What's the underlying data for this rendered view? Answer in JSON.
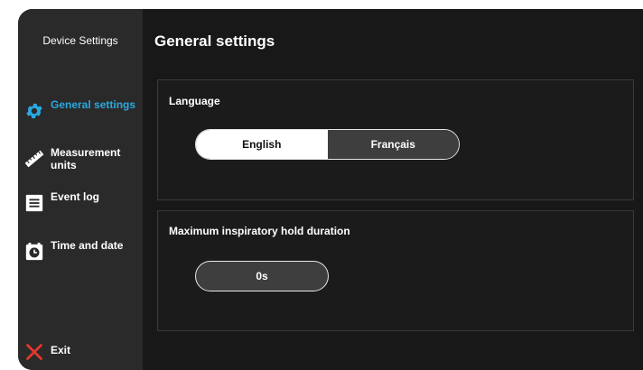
{
  "sidebar": {
    "title": "Device Settings",
    "items": [
      {
        "label": "General settings",
        "icon": "gear-icon",
        "active": true
      },
      {
        "label": "Measurement units",
        "icon": "ruler-icon",
        "active": false
      },
      {
        "label": "Event log",
        "icon": "event-log-icon",
        "active": false
      },
      {
        "label": "Time and date",
        "icon": "clock-icon",
        "active": false
      }
    ],
    "exit_label": "Exit",
    "exit_icon": "close-icon"
  },
  "main": {
    "title": "General settings",
    "language": {
      "label": "Language",
      "options": [
        "English",
        "Français"
      ],
      "selected": "English"
    },
    "hold": {
      "label": "Maximum inspiratory hold duration",
      "value": "0s"
    }
  },
  "colors": {
    "accent": "#2aa9e0",
    "exit": "#e8372a",
    "background": "#181818",
    "sidebar": "#2a2a2a"
  }
}
